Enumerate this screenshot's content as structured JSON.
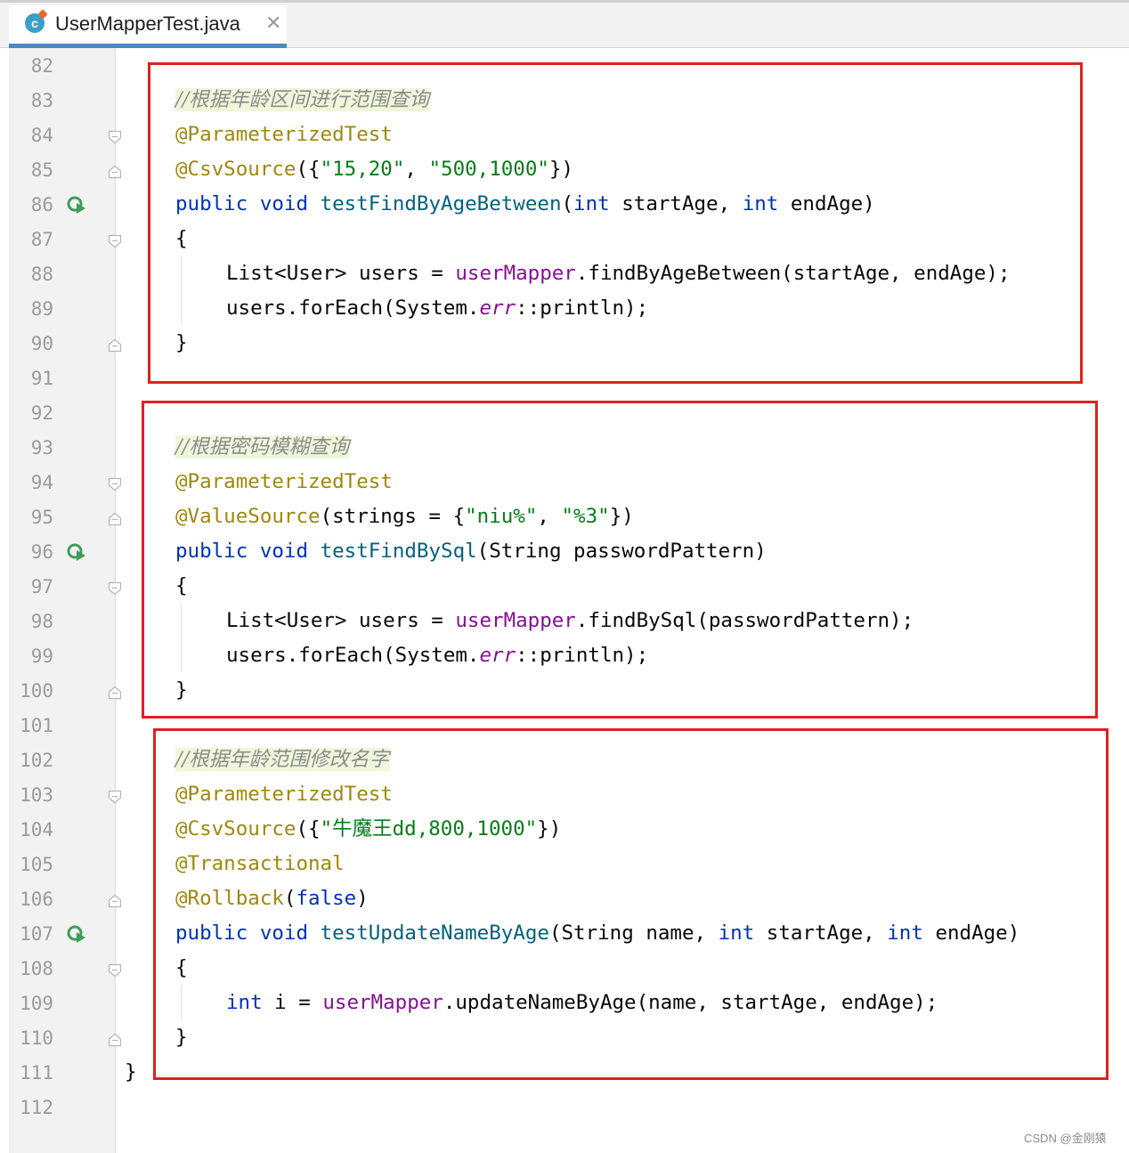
{
  "tab": {
    "title": "UserMapperTest.java",
    "icon": "java-class-icon",
    "close": "✕"
  },
  "line_numbers": [
    "82",
    "83",
    "84",
    "85",
    "86",
    "87",
    "88",
    "89",
    "90",
    "91",
    "92",
    "93",
    "94",
    "95",
    "96",
    "97",
    "98",
    "99",
    "100",
    "101",
    "102",
    "103",
    "104",
    "105",
    "106",
    "107",
    "108",
    "109",
    "110",
    "111",
    "112"
  ],
  "code": {
    "block1": {
      "comment": "//根据年龄区间进行范围查询",
      "ann1": "@ParameterizedTest",
      "ann2": "@CsvSource",
      "ann2_args_open": "({",
      "ann2_str1": "\"15,20\"",
      "ann2_sep": ", ",
      "ann2_str2": "\"500,1000\"",
      "ann2_args_close": "})",
      "sig_public": "public",
      "sig_void": "void",
      "sig_name": "testFindByAgeBetween",
      "sig_open": "(",
      "sig_int1": "int",
      "sig_p1": " startAge, ",
      "sig_int2": "int",
      "sig_p2": " endAge)",
      "brace_open": "{",
      "body1_pre": "List<User> users = ",
      "body1_field": "userMapper",
      "body1_post": ".findByAgeBetween(startAge, endAge);",
      "body2_pre": "users.forEach(System.",
      "body2_field": "err",
      "body2_post": "::println);",
      "brace_close": "}"
    },
    "block2": {
      "comment": "//根据密码模糊查询",
      "ann1": "@ParameterizedTest",
      "ann2": "@ValueSource",
      "ann2_mid": "(strings = {",
      "ann2_str1": "\"niu%\"",
      "ann2_sep": ", ",
      "ann2_str2": "\"%3\"",
      "ann2_close": "})",
      "sig_public": "public",
      "sig_void": "void",
      "sig_name": "testFindBySql",
      "sig_rest": "(String passwordPattern)",
      "brace_open": "{",
      "body1_pre": "List<User> users = ",
      "body1_field": "userMapper",
      "body1_post": ".findBySql(passwordPattern);",
      "body2_pre": "users.forEach(System.",
      "body2_field": "err",
      "body2_post": "::println);",
      "brace_close": "}"
    },
    "block3": {
      "comment": "//根据年龄范围修改名字",
      "ann1": "@ParameterizedTest",
      "ann2": "@CsvSource",
      "ann2_open": "({",
      "ann2_str": "\"牛魔王dd,800,1000\"",
      "ann2_close": "})",
      "ann3": "@Transactional",
      "ann4": "@Rollback",
      "ann4_open": "(",
      "ann4_kw": "false",
      "ann4_close": ")",
      "sig_public": "public",
      "sig_void": "void",
      "sig_name": "testUpdateNameByAge",
      "sig_p0": "(String name, ",
      "sig_int1": "int",
      "sig_p1": " startAge, ",
      "sig_int2": "int",
      "sig_p2": " endAge)",
      "brace_open": "{",
      "body1_int": "int",
      "body1_pre": " i = ",
      "body1_field": "userMapper",
      "body1_post": ".updateNameByAge(name, startAge, endAge);",
      "brace_close": "}"
    },
    "class_close": "}"
  },
  "watermark": "CSDN @金刚猿",
  "colors": {
    "highlight_box": "#e02020",
    "keyword": "#0033b3",
    "annotation": "#9e880d",
    "string": "#067d17",
    "field": "#871094"
  }
}
